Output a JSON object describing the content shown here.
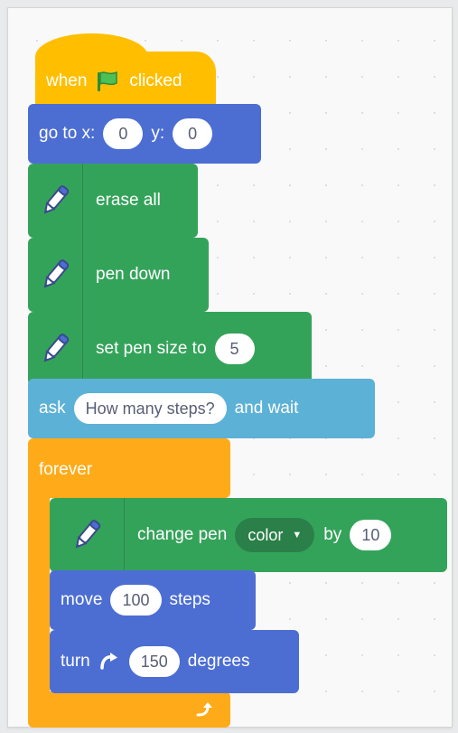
{
  "colors": {
    "events": "#ffbf00",
    "motion": "#4c6ed3",
    "pen": "#34a35a",
    "pen_dark": "#2a8048",
    "sensing": "#5cb1d6",
    "control": "#ffab19",
    "field_text": "#575e75"
  },
  "when_flag": {
    "when": "when",
    "icon": "green-flag-icon",
    "clicked": "clicked"
  },
  "go_to": {
    "label": "go to x:",
    "x": "0",
    "y_label": "y:",
    "y": "0"
  },
  "erase_all": {
    "icon": "pen-icon",
    "label": "erase all"
  },
  "pen_down": {
    "icon": "pen-icon",
    "label": "pen down"
  },
  "set_pen_size": {
    "icon": "pen-icon",
    "label": "set pen size to",
    "value": "5"
  },
  "ask": {
    "label": "ask",
    "question": "How many steps?",
    "suffix": "and wait"
  },
  "forever": {
    "label": "forever",
    "loop_icon": "loop-arrow-icon"
  },
  "change_pen": {
    "icon": "pen-icon",
    "label": "change pen",
    "param": "color",
    "by": "by",
    "value": "10"
  },
  "move": {
    "label": "move",
    "value": "100",
    "suffix": "steps"
  },
  "turn": {
    "label": "turn",
    "icon": "rotate-clockwise-icon",
    "value": "150",
    "suffix": "degrees"
  }
}
